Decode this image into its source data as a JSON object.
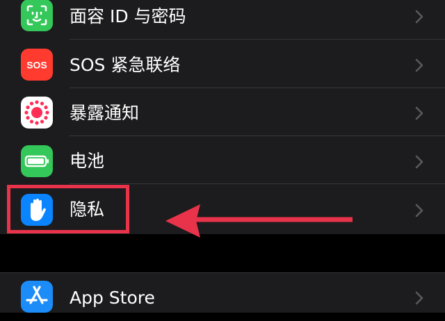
{
  "settings": {
    "group1": [
      {
        "label": "面容 ID 与密码",
        "icon": "face-id-icon",
        "color": "#34c759"
      },
      {
        "label": "SOS 紧急联络",
        "icon": "sos-icon",
        "color": "#ff3b30",
        "icon_text": "SOS"
      },
      {
        "label": "暴露通知",
        "icon": "exposure-notification-icon",
        "color": "#ffffff"
      },
      {
        "label": "电池",
        "icon": "battery-icon",
        "color": "#34c759"
      },
      {
        "label": "隐私",
        "icon": "privacy-hand-icon",
        "color": "#0a84ff"
      }
    ],
    "group2": [
      {
        "label": "App Store",
        "icon": "app-store-icon",
        "color": "#1c8cf8"
      }
    ]
  },
  "annotation": {
    "highlight_color": "#e8334a"
  }
}
